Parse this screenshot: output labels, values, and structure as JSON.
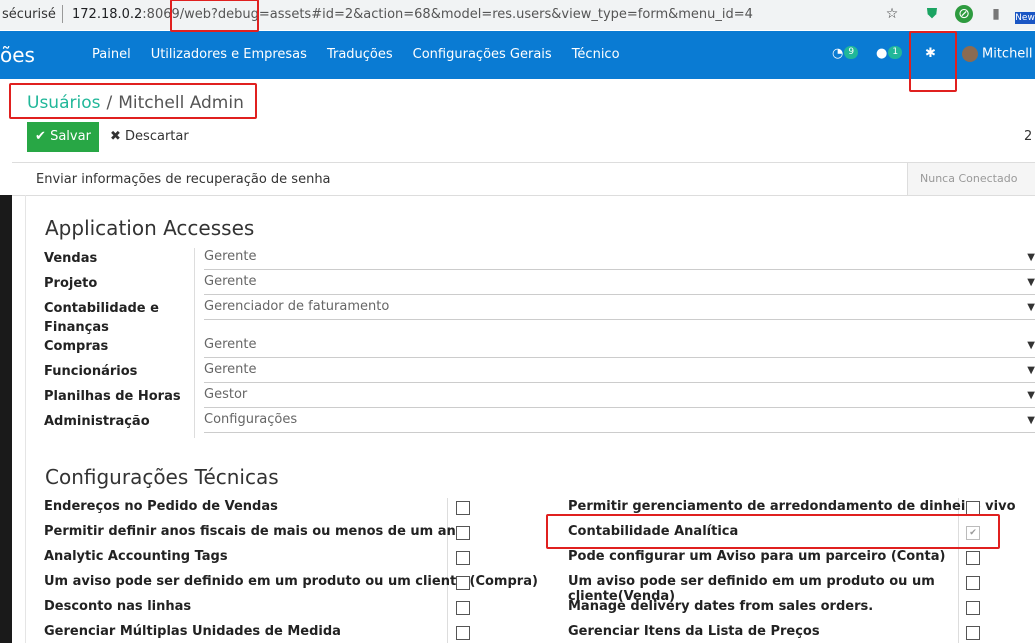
{
  "browser": {
    "security_label": "sécurisé",
    "url_host": "172.18.0.2",
    "url_rest": ":8069/web?debug=assets#id=2&action=68&model=res.users&view_type=form&menu_id=4",
    "new_badge": "New"
  },
  "nav": {
    "brand": "ões",
    "menu": [
      "Painel",
      "Utilizadores e Empresas",
      "Traduções",
      "Configurações Gerais",
      "Técnico"
    ],
    "activity_count": "9",
    "messages_count": "1",
    "user_name": "Mitchell A"
  },
  "breadcrumb": {
    "parent": "Usuários",
    "separator": "/",
    "current": "Mitchell Admin"
  },
  "toolbar": {
    "save_label": "Salvar",
    "discard_label": "Descartar",
    "pager": "2"
  },
  "statusbar": {
    "action": "Enviar informações de recuperação de senha",
    "state": "Nunca Conectado"
  },
  "application_accesses": {
    "title": "Application Accesses",
    "rows": [
      {
        "label": "Vendas",
        "value": "Gerente"
      },
      {
        "label": "Projeto",
        "value": "Gerente"
      },
      {
        "label": "Contabilidade e Finanças",
        "value": "Gerenciador de faturamento"
      },
      {
        "label": "Compras",
        "value": "Gerente"
      },
      {
        "label": "Funcionários",
        "value": "Gerente"
      },
      {
        "label": "Planilhas de Horas",
        "value": "Gestor"
      },
      {
        "label": "Administração",
        "value": "Configurações"
      }
    ]
  },
  "technical": {
    "title": "Configurações Técnicas",
    "left": [
      {
        "label": "Endereços no Pedido de Vendas",
        "checked": false
      },
      {
        "label": "Permitir definir anos fiscais de mais ou menos de um ano",
        "checked": false
      },
      {
        "label": "Analytic Accounting Tags",
        "checked": false
      },
      {
        "label": "Um aviso pode ser definido em um produto ou um cliente (Compra)",
        "checked": false
      },
      {
        "label": "Desconto nas linhas",
        "checked": false
      },
      {
        "label": "Gerenciar Múltiplas Unidades de Medida",
        "checked": false
      }
    ],
    "right": [
      {
        "label": "Permitir gerenciamento de arredondamento de dinheiro vivo",
        "checked": false
      },
      {
        "label": "Contabilidade Analítica",
        "checked": true
      },
      {
        "label": "Pode configurar um Aviso para um parceiro (Conta)",
        "checked": false
      },
      {
        "label": "Um aviso pode ser definido em um produto ou um cliente(Venda)",
        "checked": false
      },
      {
        "label": "Manage delivery dates from sales orders.",
        "checked": false
      },
      {
        "label": "Gerenciar Itens da Lista de Preços",
        "checked": false
      }
    ]
  },
  "colors": {
    "nav": "#0a7bd3",
    "accent": "#21b799",
    "save": "#28a745",
    "highlight": "#e0201f"
  }
}
